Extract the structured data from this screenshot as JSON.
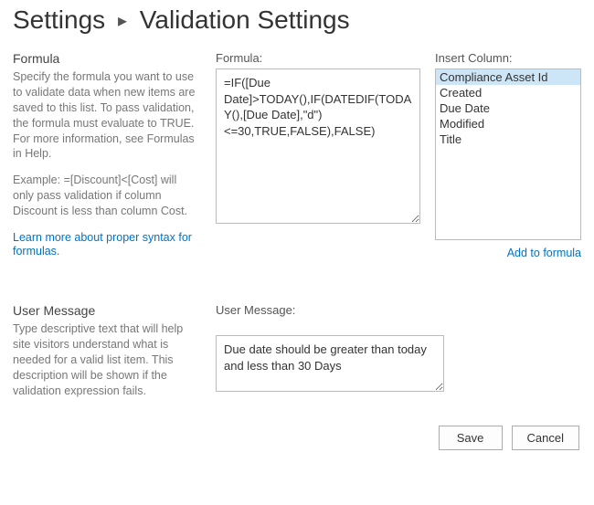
{
  "breadcrumb": {
    "root": "Settings",
    "current": "Validation Settings"
  },
  "formula_section": {
    "title": "Formula",
    "help1": "Specify the formula you want to use to validate data when new items are saved to this list. To pass validation, the formula must evaluate to TRUE. For more information, see Formulas in Help.",
    "help2": "Example: =[Discount]<[Cost] will only pass validation if column Discount is less than column Cost.",
    "learn_link": "Learn more about proper syntax for formulas.",
    "formula_label": "Formula:",
    "formula_value": "=IF([Due Date]>TODAY(),IF(DATEDIF(TODAY(),[Due Date],\"d\")<=30,TRUE,FALSE),FALSE)",
    "insert_label": "Insert Column:",
    "columns": [
      "Compliance Asset Id",
      "Created",
      "Due Date",
      "Modified",
      "Title"
    ],
    "selected_column_index": 0,
    "add_link": "Add to formula"
  },
  "message_section": {
    "title": "User Message",
    "help": "Type descriptive text that will help site visitors understand what is needed for a valid list item. This description will be shown if the validation expression fails.",
    "label": "User Message:",
    "value": "Due date should be greater than today and less than 30 Days"
  },
  "buttons": {
    "save": "Save",
    "cancel": "Cancel"
  }
}
